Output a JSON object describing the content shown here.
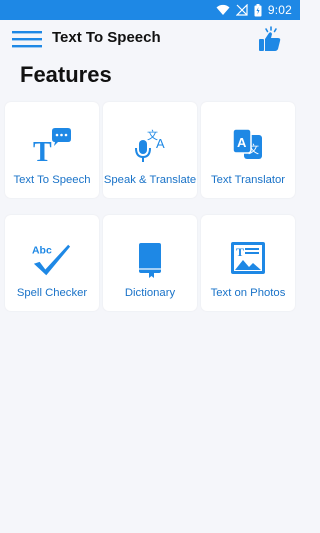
{
  "status_bar": {
    "time": "9:02"
  },
  "app_bar": {
    "title": "Text To Speech"
  },
  "section": {
    "title": "Features"
  },
  "features": [
    {
      "label": "Text To Speech",
      "icon": "text-speech-icon"
    },
    {
      "label": "Speak & Translate",
      "icon": "mic-translate-icon"
    },
    {
      "label": "Text Translator",
      "icon": "translator-icon"
    },
    {
      "label": "Spell Checker",
      "icon": "spell-check-icon"
    },
    {
      "label": "Dictionary",
      "icon": "book-icon"
    },
    {
      "label": "Text on Photos",
      "icon": "photo-text-icon"
    }
  ],
  "colors": {
    "accent": "#1e88e5",
    "label": "#1a73c8",
    "background": "#f5f6fa"
  }
}
